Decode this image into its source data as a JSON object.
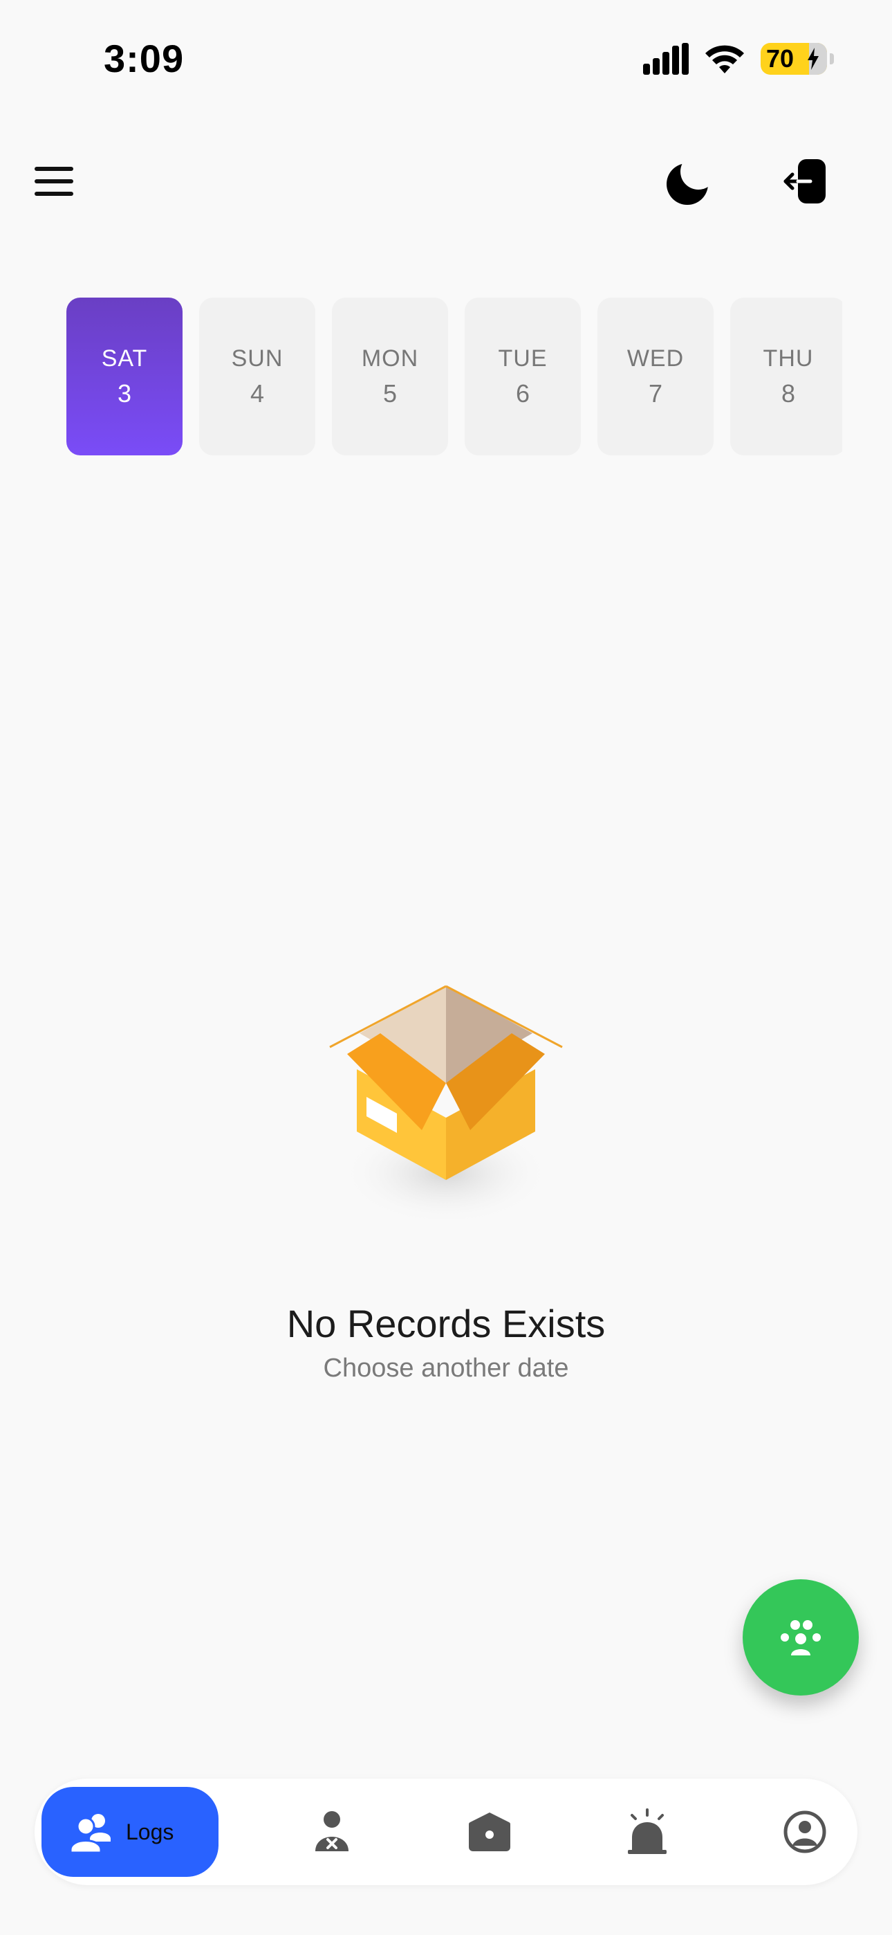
{
  "status_bar": {
    "time": "3:09",
    "battery_level": "70",
    "icons": [
      "cellular-signal-icon",
      "wifi-icon",
      "battery-charging-icon"
    ]
  },
  "top_bar": {
    "icons": [
      "hamburger-menu-icon",
      "moon-icon",
      "logout-icon"
    ]
  },
  "date_strip": {
    "selected_index": 0,
    "days": [
      {
        "day": "SAT",
        "date": "3"
      },
      {
        "day": "SUN",
        "date": "4"
      },
      {
        "day": "MON",
        "date": "5"
      },
      {
        "day": "TUE",
        "date": "6"
      },
      {
        "day": "WED",
        "date": "7"
      },
      {
        "day": "THU",
        "date": "8"
      }
    ]
  },
  "empty_state": {
    "title": "No Records Exists",
    "subtitle": "Choose another date",
    "icon": "open-box-icon"
  },
  "fab": {
    "icon": "group-icon"
  },
  "bottom_nav": {
    "items": [
      {
        "label": "Logs",
        "icon": "users-icon",
        "active": true
      },
      {
        "label": "",
        "icon": "user-absent-icon",
        "active": false
      },
      {
        "label": "",
        "icon": "home-icon",
        "active": false
      },
      {
        "label": "",
        "icon": "alarm-icon",
        "active": false
      },
      {
        "label": "",
        "icon": "profile-icon",
        "active": false
      }
    ]
  },
  "colors": {
    "background": "#f9f9f9",
    "selected_date_top": "#6a3fc4",
    "selected_date_bottom": "#7a4cf7",
    "fab": "#34c759",
    "nav_active": "#2962ff",
    "battery": "#ffd21c"
  }
}
